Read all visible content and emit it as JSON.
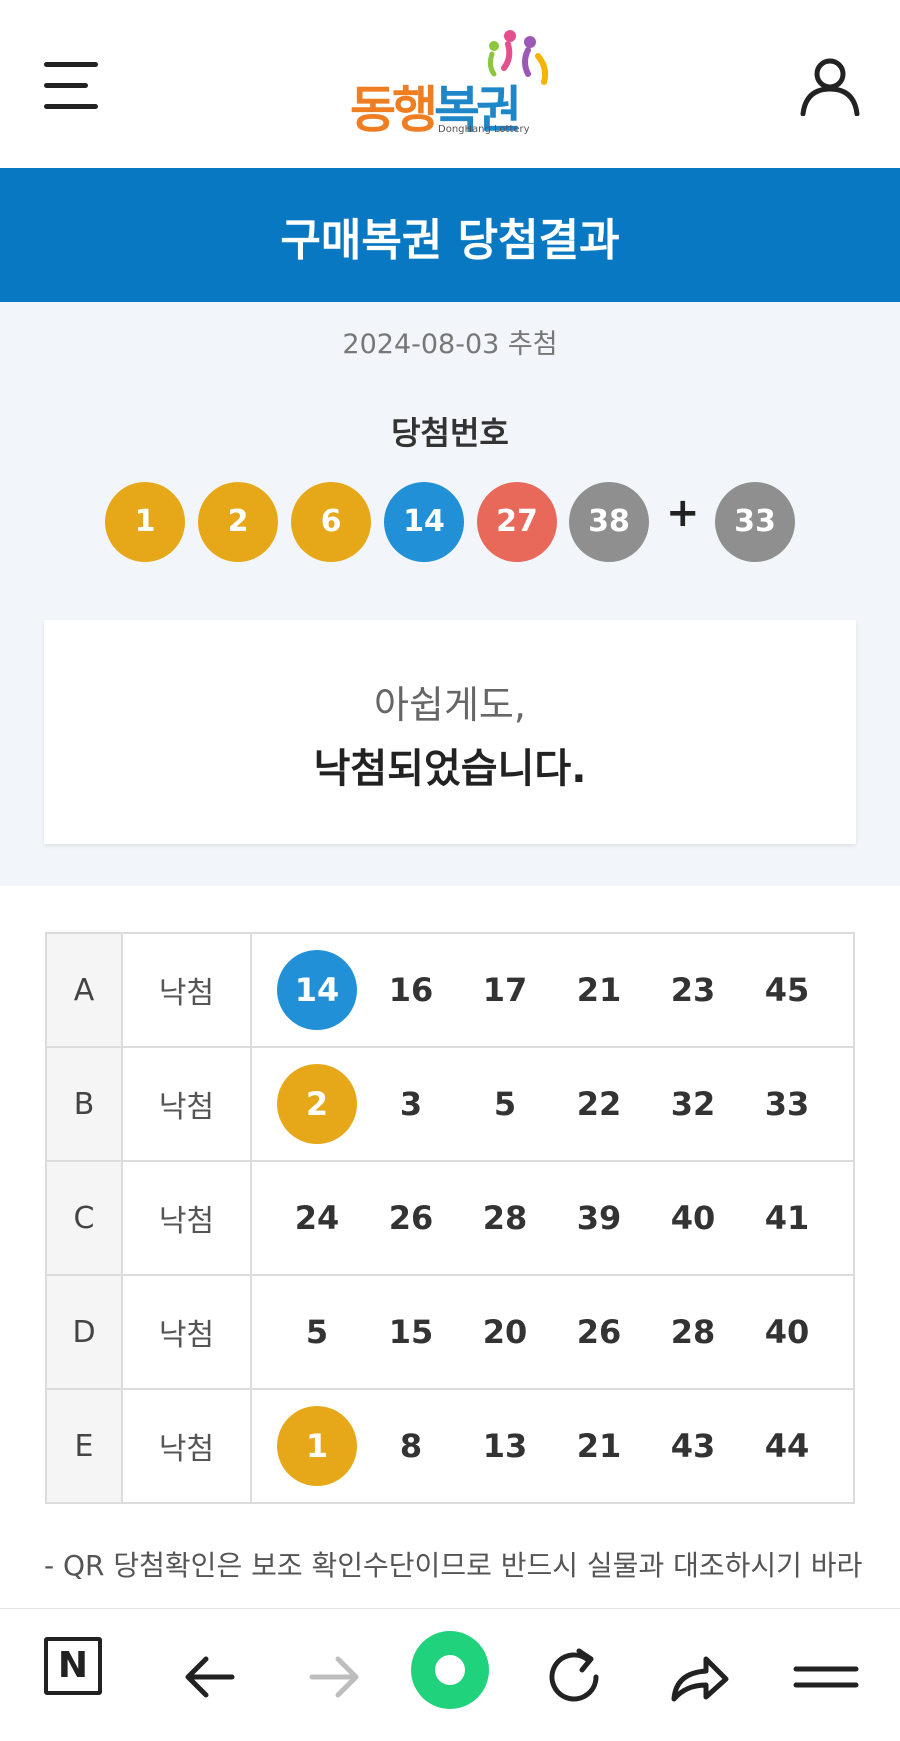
{
  "header": {
    "menu_icon": "hamburger-menu-icon",
    "logo_part1": "동행",
    "logo_part2": "복권",
    "logo_sub": "DongHang Lottery",
    "user_icon": "user-profile-icon"
  },
  "title": "구매복권 당첨결과",
  "draw_date": "2024-08-03 추첨",
  "winning_label": "당첨번호",
  "winning_numbers": [
    {
      "value": "1",
      "color": "#e6a818"
    },
    {
      "value": "2",
      "color": "#e6a818"
    },
    {
      "value": "6",
      "color": "#e6a818"
    },
    {
      "value": "14",
      "color": "#2190d6"
    },
    {
      "value": "27",
      "color": "#e8685a"
    },
    {
      "value": "38",
      "color": "#8f8f8f"
    }
  ],
  "plus_sign": "+",
  "bonus_number": {
    "value": "33",
    "color": "#8f8f8f"
  },
  "result_message": {
    "line1": "아쉽게도,",
    "line2": "낙첨되었습니다."
  },
  "tickets": [
    {
      "label": "A",
      "status": "낙첨",
      "numbers": [
        "14",
        "16",
        "17",
        "21",
        "23",
        "45"
      ],
      "matched": [
        0
      ]
    },
    {
      "label": "B",
      "status": "낙첨",
      "numbers": [
        "2",
        "3",
        "5",
        "22",
        "32",
        "33"
      ],
      "matched": [
        0
      ]
    },
    {
      "label": "C",
      "status": "낙첨",
      "numbers": [
        "24",
        "26",
        "28",
        "39",
        "40",
        "41"
      ],
      "matched": []
    },
    {
      "label": "D",
      "status": "낙첨",
      "numbers": [
        "5",
        "15",
        "20",
        "26",
        "28",
        "40"
      ],
      "matched": []
    },
    {
      "label": "E",
      "status": "낙첨",
      "numbers": [
        "1",
        "8",
        "13",
        "21",
        "43",
        "44"
      ],
      "matched": [
        0
      ]
    }
  ],
  "notice": "- QR 당첨확인은 보조 확인수단이므로 반드시 실물과 대조하시기 바라",
  "bottom_bar": {
    "n_label": "N",
    "icons": [
      "naver-n-icon",
      "back-arrow-icon",
      "forward-arrow-icon",
      "green-home-icon",
      "refresh-icon",
      "share-icon",
      "menu-icon"
    ]
  },
  "colors": {
    "brand_blue": "#0978c3",
    "ball_yellow": "#e6a818",
    "ball_blue": "#2190d6",
    "ball_red": "#e8685a",
    "ball_gray": "#8f8f8f",
    "green": "#1fd27b"
  }
}
